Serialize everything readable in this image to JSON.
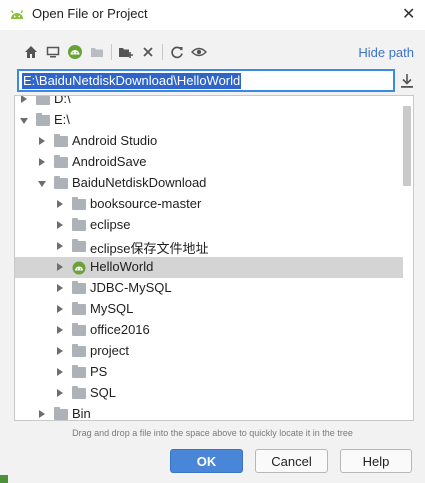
{
  "window": {
    "title": "Open File or Project",
    "close_glyph": "✕"
  },
  "toolbar": {
    "icons": [
      "home-icon",
      "desktop-icon",
      "project-icon",
      "folder-icon",
      "new-folder-icon",
      "delete-icon",
      "refresh-icon",
      "show-hidden-icon"
    ],
    "hide_path_label": "Hide path"
  },
  "path": {
    "value": "E:\\BaiduNetdiskDownload\\HelloWorld"
  },
  "tree": {
    "items": [
      {
        "label": "D:\\",
        "depth": 1,
        "expanded": false,
        "partial": true
      },
      {
        "label": "E:\\",
        "depth": 1,
        "expanded": true
      },
      {
        "label": "Android Studio",
        "depth": 2,
        "expanded": false
      },
      {
        "label": "AndroidSave",
        "depth": 2,
        "expanded": false
      },
      {
        "label": "BaiduNetdiskDownload",
        "depth": 2,
        "expanded": true
      },
      {
        "label": "booksource-master",
        "depth": 3,
        "expanded": false
      },
      {
        "label": "eclipse",
        "depth": 3,
        "expanded": false
      },
      {
        "label": "eclipse保存文件地址",
        "depth": 3,
        "expanded": false
      },
      {
        "label": "HelloWorld",
        "depth": 3,
        "expanded": false,
        "selected": true,
        "icon": "android-project-icon"
      },
      {
        "label": "JDBC-MySQL",
        "depth": 3,
        "expanded": false
      },
      {
        "label": "MySQL",
        "depth": 3,
        "expanded": false
      },
      {
        "label": "office2016",
        "depth": 3,
        "expanded": false
      },
      {
        "label": "project",
        "depth": 3,
        "expanded": false
      },
      {
        "label": "PS",
        "depth": 3,
        "expanded": false
      },
      {
        "label": "SQL",
        "depth": 3,
        "expanded": false
      },
      {
        "label": "Bin",
        "depth": 2,
        "expanded": false
      }
    ]
  },
  "hint": "Drag and drop a file into the space above to quickly locate it in the tree",
  "buttons": {
    "ok": "OK",
    "cancel": "Cancel",
    "help": "Help"
  },
  "colors": {
    "accent": "#3a8ae2",
    "link": "#3c73c8",
    "ok_button": "#4a86d8",
    "selection": "#2f65ca"
  }
}
